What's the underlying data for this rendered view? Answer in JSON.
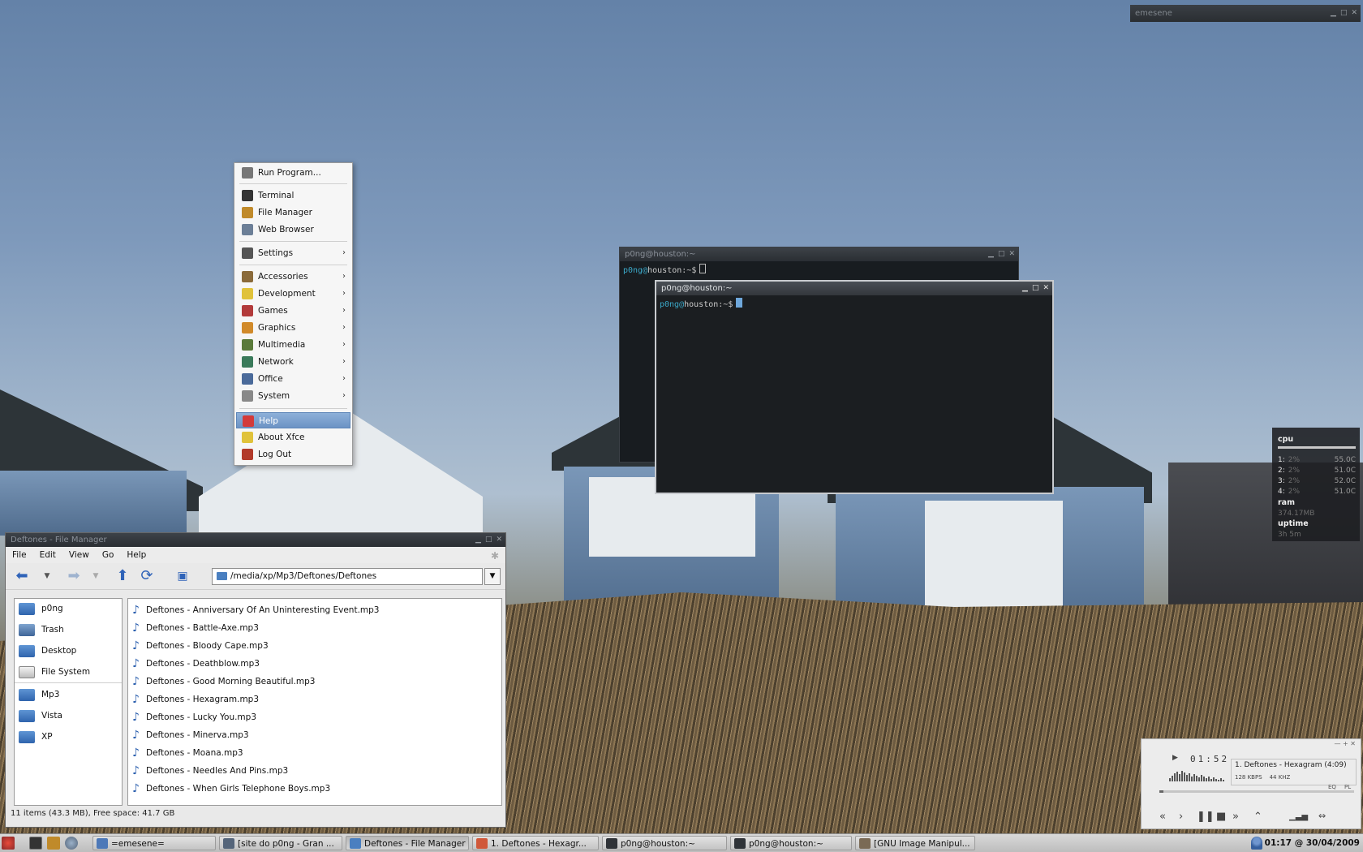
{
  "emesene": {
    "title": "emesene"
  },
  "menu": {
    "items": [
      {
        "label": "Run Program...",
        "icon": "run-icon",
        "color": "#777777",
        "submenu": false
      },
      {
        "label": "Terminal",
        "icon": "terminal-icon",
        "color": "#333333",
        "submenu": false
      },
      {
        "label": "File Manager",
        "icon": "file-manager-icon",
        "color": "#c08a2a",
        "submenu": false
      },
      {
        "label": "Web Browser",
        "icon": "web-browser-icon",
        "color": "#6c7f97",
        "submenu": false
      },
      {
        "label": "Settings",
        "icon": "settings-icon",
        "color": "#555555",
        "submenu": true
      },
      {
        "label": "Accessories",
        "icon": "accessories-icon",
        "color": "#8a6a3a",
        "submenu": true
      },
      {
        "label": "Development",
        "icon": "development-icon",
        "color": "#e0c23a",
        "submenu": true
      },
      {
        "label": "Games",
        "icon": "games-icon",
        "color": "#b23a3a",
        "submenu": true
      },
      {
        "label": "Graphics",
        "icon": "graphics-icon",
        "color": "#d18a2a",
        "submenu": true
      },
      {
        "label": "Multimedia",
        "icon": "multimedia-icon",
        "color": "#5a7a3a",
        "submenu": true
      },
      {
        "label": "Network",
        "icon": "network-icon",
        "color": "#3a7a5a",
        "submenu": true
      },
      {
        "label": "Office",
        "icon": "office-icon",
        "color": "#4a6a9a",
        "submenu": true
      },
      {
        "label": "System",
        "icon": "system-icon",
        "color": "#888888",
        "submenu": true
      },
      {
        "label": "Help",
        "icon": "help-icon",
        "color": "#d33a3a",
        "submenu": false,
        "highlighted": true
      },
      {
        "label": "About Xfce",
        "icon": "about-xfce-icon",
        "color": "#e0c23a",
        "submenu": false
      },
      {
        "label": "Log Out",
        "icon": "log-out-icon",
        "color": "#b23a2a",
        "submenu": false
      }
    ]
  },
  "terminal_back": {
    "title": "p0ng@houston:~",
    "user": "p0ng",
    "at": "@",
    "host": "houston",
    "prompt": ":~$"
  },
  "terminal_front": {
    "title": "p0ng@houston:~",
    "user": "p0ng",
    "at": "@",
    "host": "houston",
    "prompt": ":~$"
  },
  "file_manager": {
    "title": "Deftones - File Manager",
    "menus": [
      "File",
      "Edit",
      "View",
      "Go",
      "Help"
    ],
    "path": "/media/xp/Mp3/Deftones/Deftones",
    "sidebar": [
      "p0ng",
      "Trash",
      "Desktop",
      "File System",
      "Mp3",
      "Vista",
      "XP"
    ],
    "files": [
      "Deftones - Anniversary Of An Uninteresting Event.mp3",
      "Deftones - Battle-Axe.mp3",
      "Deftones - Bloody Cape.mp3",
      "Deftones - Deathblow.mp3",
      "Deftones - Good Morning Beautiful.mp3",
      "Deftones - Hexagram.mp3",
      "Deftones - Lucky You.mp3",
      "Deftones - Minerva.mp3",
      "Deftones - Moana.mp3",
      "Deftones - Needles And Pins.mp3",
      "Deftones - When Girls Telephone Boys.mp3"
    ],
    "status": "11 items (43.3 MB), Free space: 41.7 GB"
  },
  "conky": {
    "cpu_label": "cpu",
    "cores": [
      {
        "id": "1:",
        "pct": "2%",
        "temp": "55.0C"
      },
      {
        "id": "2:",
        "pct": "2%",
        "temp": "51.0C"
      },
      {
        "id": "3:",
        "pct": "2%",
        "temp": "52.0C"
      },
      {
        "id": "4:",
        "pct": "2%",
        "temp": "51.0C"
      }
    ],
    "ram_label": "ram",
    "ram_value": "374.17MB",
    "uptime_label": "uptime",
    "uptime_value": "3h 5m"
  },
  "player": {
    "time": "01:52",
    "track": "1. Deftones - Hexagram (4:09)",
    "kbps": "128 KBPS",
    "khz": "44 KHZ",
    "eq": "EQ",
    "pl": "PL",
    "seek_fraction": 0.02
  },
  "taskbar": {
    "tasks": [
      {
        "label": "=emesene=",
        "icon": "emesene-icon"
      },
      {
        "label": "[site do p0ng - Gran ...",
        "icon": "browser-icon"
      },
      {
        "label": "Deftones - File Manager",
        "icon": "folder-icon",
        "active": true
      },
      {
        "label": "1. Deftones - Hexagr...",
        "icon": "audacious-icon"
      },
      {
        "label": "p0ng@houston:~",
        "icon": "terminal-icon"
      },
      {
        "label": "p0ng@houston:~",
        "icon": "terminal-icon"
      },
      {
        "label": "[GNU Image Manipul...",
        "icon": "gimp-icon"
      }
    ],
    "clock": "01:17 @ 30/04/2009"
  }
}
